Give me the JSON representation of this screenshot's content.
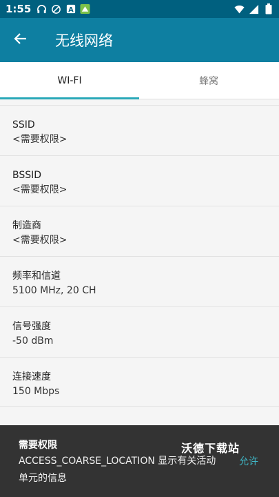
{
  "status_bar": {
    "time": "1:55",
    "icons": [
      "headset-icon",
      "no-sync-icon",
      "a-box-icon",
      "app-notification-icon",
      "wifi-icon",
      "cellular-icon",
      "battery-icon"
    ]
  },
  "app_bar": {
    "title": "无线网络",
    "back_icon": "arrow-left-icon"
  },
  "tabs": [
    {
      "label": "WI-FI",
      "active": true
    },
    {
      "label": "蜂窝",
      "active": false
    }
  ],
  "rows": [
    {
      "label": "SSID",
      "value": "<需要权限>"
    },
    {
      "label": "BSSID",
      "value": "<需要权限>"
    },
    {
      "label": "制造商",
      "value": "<需要权限>"
    },
    {
      "label": "频率和信道",
      "value": "5100 MHz, 20 CH"
    },
    {
      "label": "信号强度",
      "value": "-50 dBm"
    },
    {
      "label": "连接速度",
      "value": "150 Mbps"
    }
  ],
  "snackbar": {
    "title": "需要权限",
    "message": "ACCESS_COARSE_LOCATION 显示有关活动单元的信息",
    "action": "允许",
    "watermark": "沃德下载站"
  },
  "colors": {
    "status_bar": "#00607f",
    "app_bar": "#0e7fa1",
    "tab_indicator": "#29a8b8",
    "action": "#3fb8c8"
  }
}
